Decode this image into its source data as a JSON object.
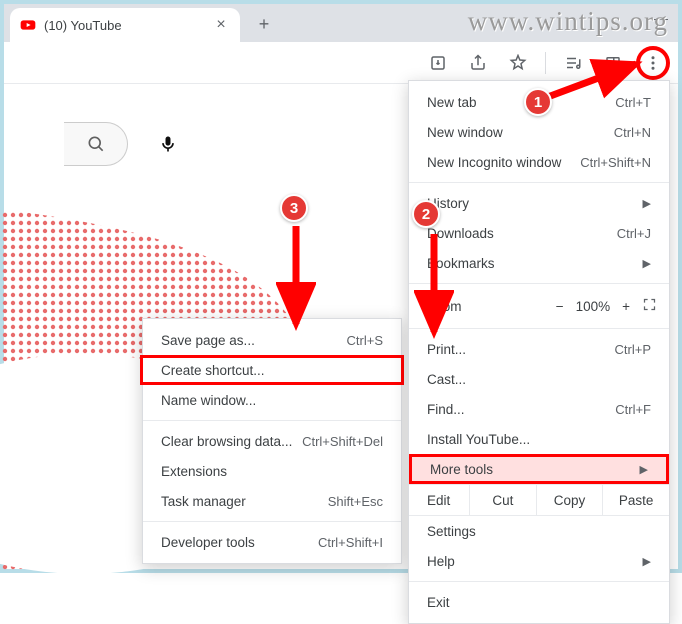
{
  "watermark": "www.wintips.org",
  "tab": {
    "title": "(10) YouTube"
  },
  "menu": {
    "new_tab": {
      "label": "New tab",
      "short": "Ctrl+T"
    },
    "new_window": {
      "label": "New window",
      "short": "Ctrl+N"
    },
    "new_incognito": {
      "label": "New Incognito window",
      "short": "Ctrl+Shift+N"
    },
    "history": {
      "label": "History"
    },
    "downloads": {
      "label": "Downloads",
      "short": "Ctrl+J"
    },
    "bookmarks": {
      "label": "Bookmarks"
    },
    "zoom": {
      "label": "Zoom",
      "minus": "−",
      "value": "100%",
      "plus": "+"
    },
    "print": {
      "label": "Print...",
      "short": "Ctrl+P"
    },
    "cast": {
      "label": "Cast..."
    },
    "find": {
      "label": "Find...",
      "short": "Ctrl+F"
    },
    "install": {
      "label": "Install YouTube..."
    },
    "more_tools": {
      "label": "More tools"
    },
    "edit": {
      "label": "Edit",
      "cut": "Cut",
      "copy": "Copy",
      "paste": "Paste"
    },
    "settings": {
      "label": "Settings"
    },
    "help": {
      "label": "Help"
    },
    "exit": {
      "label": "Exit"
    }
  },
  "submenu": {
    "save_page": {
      "label": "Save page as...",
      "short": "Ctrl+S"
    },
    "create_shortcut": {
      "label": "Create shortcut..."
    },
    "name_window": {
      "label": "Name window..."
    },
    "clear_data": {
      "label": "Clear browsing data...",
      "short": "Ctrl+Shift+Del"
    },
    "extensions": {
      "label": "Extensions"
    },
    "task_manager": {
      "label": "Task manager",
      "short": "Shift+Esc"
    },
    "dev_tools": {
      "label": "Developer tools",
      "short": "Ctrl+Shift+I"
    }
  },
  "callouts": {
    "one": "1",
    "two": "2",
    "three": "3"
  }
}
